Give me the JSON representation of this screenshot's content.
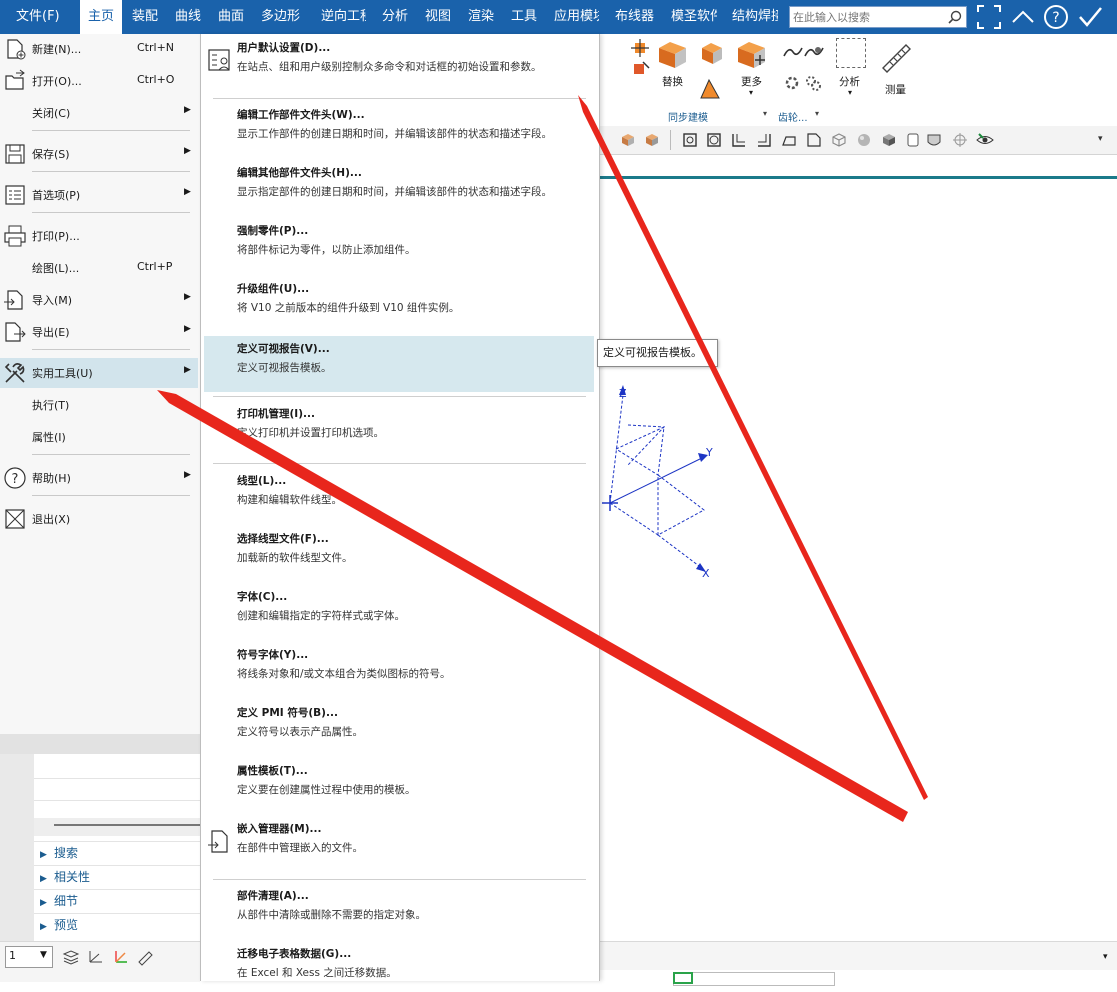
{
  "menubar": {
    "items": [
      "文件(F)",
      "主页",
      "装配",
      "曲线",
      "曲面",
      "多边形",
      "逆向工程",
      "分析",
      "视图",
      "渲染",
      "工具",
      "应用模块",
      "布线器",
      "模圣软件",
      "结构焊接"
    ],
    "active_index": 1,
    "search_placeholder": "在此输入以搜索"
  },
  "ribbon": {
    "replace_label": "替换",
    "more_label": "更多",
    "analyze_label": "分析",
    "measure_label": "测量",
    "sync_group": "同步建模",
    "gear_group": "齿轮..."
  },
  "file_menu": {
    "items": [
      {
        "label": "新建(N)...",
        "shortcut": "Ctrl+N",
        "icon": "new-file-icon"
      },
      {
        "label": "打开(O)...",
        "shortcut": "Ctrl+O",
        "icon": "open-folder-icon"
      },
      {
        "label": "关闭(C)",
        "submenu": true
      },
      {
        "label": "保存(S)",
        "submenu": true,
        "icon": "save-icon"
      },
      {
        "label": "首选项(P)",
        "submenu": true,
        "icon": "preferences-icon"
      },
      {
        "label": "打印(P)...",
        "icon": "print-icon"
      },
      {
        "label": "绘图(L)...",
        "shortcut": "Ctrl+P"
      },
      {
        "label": "导入(M)",
        "submenu": true,
        "icon": "import-icon"
      },
      {
        "label": "导出(E)",
        "submenu": true,
        "icon": "export-icon"
      },
      {
        "label": "实用工具(U)",
        "submenu": true,
        "highlighted": true,
        "icon": "utilities-icon"
      },
      {
        "label": "执行(T)"
      },
      {
        "label": "属性(I)"
      },
      {
        "label": "帮助(H)",
        "submenu": true,
        "icon": "help-icon"
      },
      {
        "label": "退出(X)",
        "icon": "exit-icon"
      }
    ]
  },
  "utilities_submenu": {
    "items": [
      {
        "title": "用户默认设置(D)...",
        "desc": "在站点、组和用户级别控制众多命令和对话框的初始设置和参数。"
      },
      {
        "title": "编辑工作部件文件头(W)...",
        "desc": "显示工作部件的创建日期和时间，并编辑该部件的状态和描述字段。"
      },
      {
        "title": "编辑其他部件文件头(H)...",
        "desc": "显示指定部件的创建日期和时间，并编辑该部件的状态和描述字段。"
      },
      {
        "title": "强制零件(P)...",
        "desc": "将部件标记为零件，以防止添加组件。"
      },
      {
        "title": "升级组件(U)...",
        "desc": "将 V10 之前版本的组件升级到 V10 组件实例。"
      },
      {
        "title": "定义可视报告(V)...",
        "desc": "定义可视报告模板。",
        "highlighted": true
      },
      {
        "title": "打印机管理(I)...",
        "desc": "定义打印机并设置打印机选项。"
      },
      {
        "title": "线型(L)...",
        "desc": "构建和编辑软件线型。"
      },
      {
        "title": "选择线型文件(F)...",
        "desc": "加载新的软件线型文件。"
      },
      {
        "title": "字体(C)...",
        "desc": "创建和编辑指定的字符样式或字体。"
      },
      {
        "title": "符号字体(Y)...",
        "desc": "将线条对象和/或文本组合为类似图标的符号。"
      },
      {
        "title": "定义 PMI 符号(B)...",
        "desc": "定义符号以表示产品属性。"
      },
      {
        "title": "属性模板(T)...",
        "desc": "定义要在创建属性过程中使用的模板。"
      },
      {
        "title": "嵌入管理器(M)...",
        "desc": "在部件中管理嵌入的文件。"
      },
      {
        "title": "部件清理(A)...",
        "desc": "从部件中清除或删除不需要的指定对象。"
      },
      {
        "title": "迁移电子表格数据(G)...",
        "desc": "在 Excel 和 Xess 之间迁移数据。"
      }
    ]
  },
  "tooltip": {
    "text": "定义可视报告模板。"
  },
  "left_panel": {
    "sections": [
      "搜索",
      "相关性",
      "细节",
      "预览"
    ]
  },
  "status_bar": {
    "layer_value": "1"
  },
  "axes": {
    "z": "Z",
    "y": "Y",
    "x": "X"
  },
  "colors": {
    "menubar": "#1a62ab",
    "highlight": "#d2e4ec",
    "annotation_arrow": "#e8261c"
  }
}
